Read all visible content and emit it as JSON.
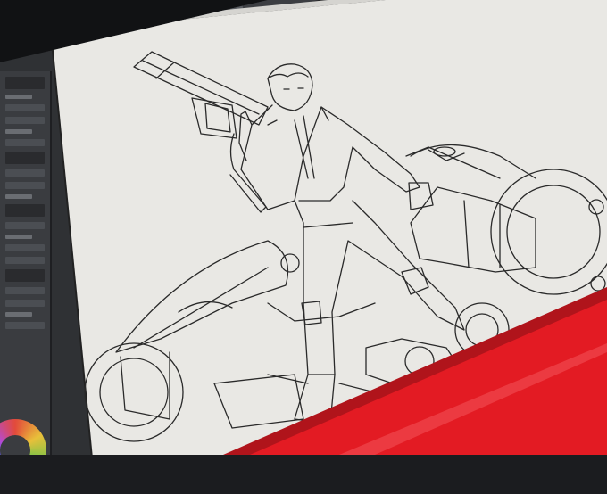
{
  "app": {
    "accent": "#e31b23",
    "canvas_color": "#e9e8e4",
    "panel_color": "#3a3c40"
  },
  "toolbar": {
    "tools": [
      "pen-icon",
      "brush-icon",
      "eraser-icon",
      "fill-icon",
      "select-icon",
      "move-icon",
      "zoom-icon",
      "hand-icon",
      "color-icon",
      "layer-icon",
      "undo-icon",
      "redo-icon"
    ]
  },
  "sidebar": {
    "sections": [
      "layer-panel",
      "brush-panel",
      "color-panel"
    ]
  },
  "canvas": {
    "subject": "line-art"
  }
}
